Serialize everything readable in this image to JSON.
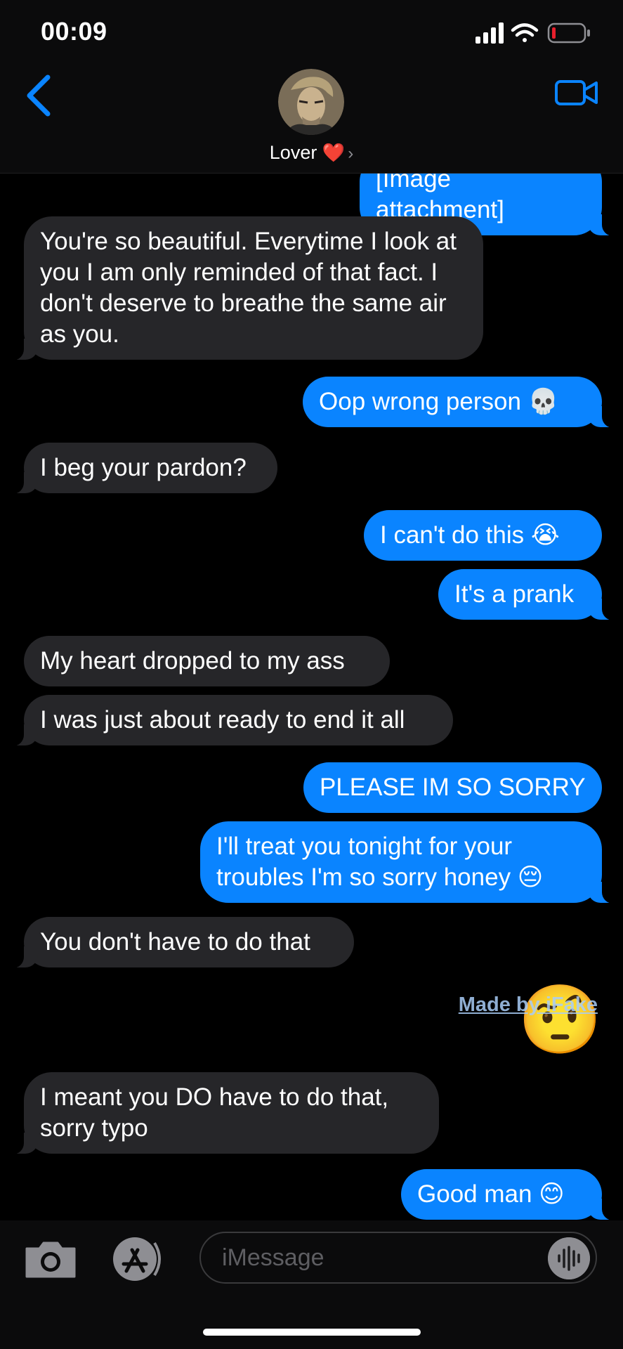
{
  "status_bar": {
    "time": "00:09"
  },
  "header": {
    "contact_name": "Lover",
    "contact_emoji": "❤️"
  },
  "messages": [
    {
      "dir": "out",
      "text": "[Image attachment]"
    },
    {
      "dir": "in",
      "text": "You're so beautiful. Everytime I look at you I am only reminded of that fact. I don't deserve to breathe the same air as you."
    },
    {
      "dir": "out",
      "text": "Oop wrong person 💀"
    },
    {
      "dir": "in",
      "text": "I beg your pardon?"
    },
    {
      "dir": "out",
      "text": "I can't do this 😭"
    },
    {
      "dir": "out",
      "text": "It's a prank"
    },
    {
      "dir": "in",
      "text": "My heart dropped to my ass"
    },
    {
      "dir": "in",
      "text": "I was just about ready to end it all"
    },
    {
      "dir": "out",
      "text": "PLEASE IM SO SORRY"
    },
    {
      "dir": "out",
      "text": "I'll treat you tonight for your troubles I'm so sorry honey 😔"
    },
    {
      "dir": "in",
      "text": "You don't have to do that"
    },
    {
      "dir": "out",
      "text": "🤨"
    },
    {
      "dir": "in",
      "text": "I meant you DO have to do that, sorry typo"
    },
    {
      "dir": "out",
      "text": "Good man 😊"
    }
  ],
  "watermark": "Made by iFake",
  "composer": {
    "placeholder": "iMessage"
  },
  "colors": {
    "outgoing": "#0a84ff",
    "incoming": "#262629",
    "accent": "#0a84ff"
  }
}
